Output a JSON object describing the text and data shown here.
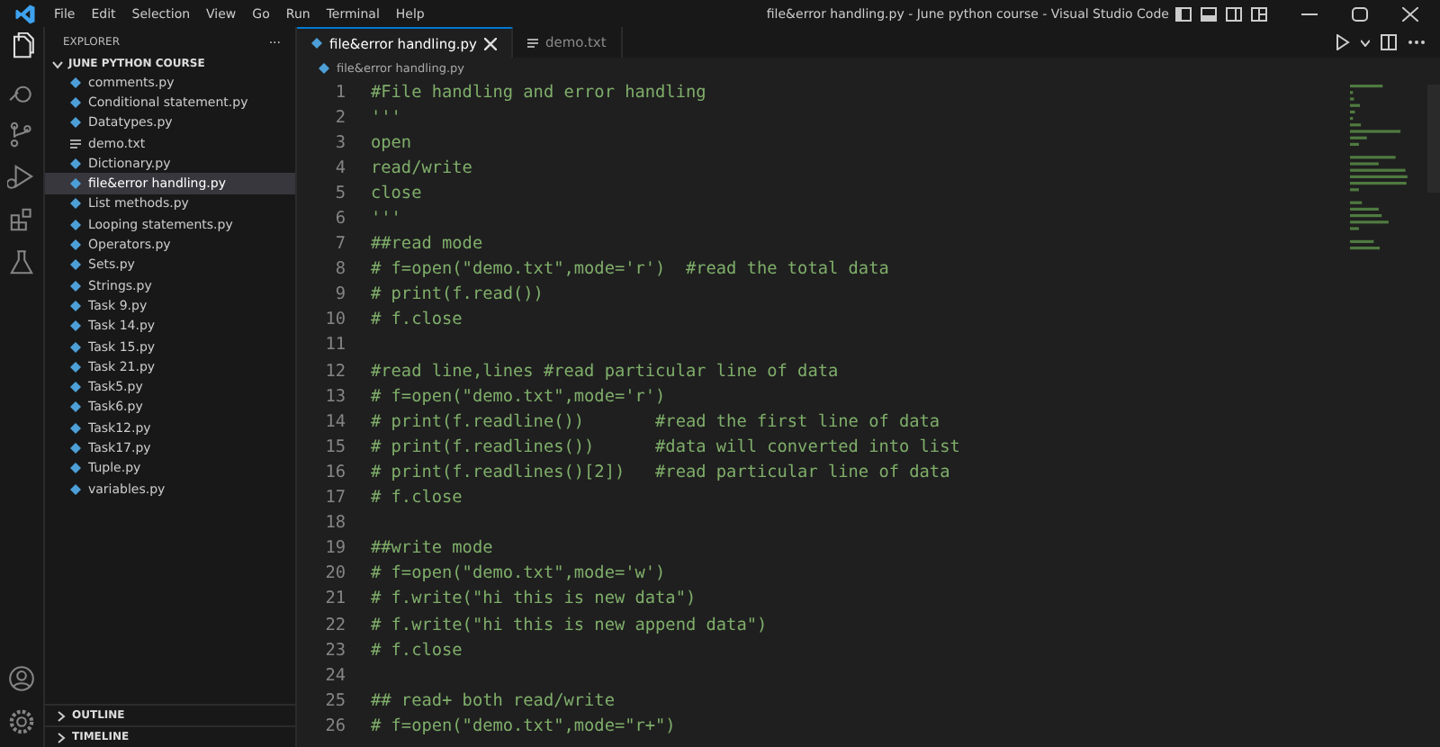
{
  "menu": [
    "File",
    "Edit",
    "Selection",
    "View",
    "Go",
    "Run",
    "Terminal",
    "Help"
  ],
  "window": {
    "title": "file&error handling.py - June python course - Visual Studio Code"
  },
  "activity_bar": [
    {
      "kind": "files",
      "selected": true
    },
    {
      "kind": "search",
      "selected": false
    },
    {
      "kind": "source-control",
      "selected": false
    },
    {
      "kind": "run",
      "selected": false
    },
    {
      "kind": "extensions",
      "selected": false
    },
    {
      "kind": "testing",
      "selected": false
    }
  ],
  "sidebar": {
    "title": "EXPLORER",
    "more": "···",
    "folder": {
      "name": "JUNE PYTHON COURSE",
      "expanded": true
    },
    "items": [
      {
        "name": "comments.py",
        "kind": "py",
        "selected": false
      },
      {
        "name": "Conditional statement.py",
        "kind": "py",
        "selected": false
      },
      {
        "name": "Datatypes.py",
        "kind": "py",
        "selected": false
      },
      {
        "name": "demo.txt",
        "kind": "txt",
        "selected": false
      },
      {
        "name": "Dictionary.py",
        "kind": "py",
        "selected": false
      },
      {
        "name": "file&error handling.py",
        "kind": "py",
        "selected": true
      },
      {
        "name": "List methods.py",
        "kind": "py",
        "selected": false
      },
      {
        "name": "Looping statements.py",
        "kind": "py",
        "selected": false
      },
      {
        "name": "Operators.py",
        "kind": "py",
        "selected": false
      },
      {
        "name": "Sets.py",
        "kind": "py",
        "selected": false
      },
      {
        "name": "Strings.py",
        "kind": "py",
        "selected": false
      },
      {
        "name": "Task 9.py",
        "kind": "py",
        "selected": false
      },
      {
        "name": "Task 14.py",
        "kind": "py",
        "selected": false
      },
      {
        "name": "Task 15.py",
        "kind": "py",
        "selected": false
      },
      {
        "name": "Task 21.py",
        "kind": "py",
        "selected": false
      },
      {
        "name": "Task5.py",
        "kind": "py",
        "selected": false
      },
      {
        "name": "Task6.py",
        "kind": "py",
        "selected": false
      },
      {
        "name": "Task12.py",
        "kind": "py",
        "selected": false
      },
      {
        "name": "Task17.py",
        "kind": "py",
        "selected": false
      },
      {
        "name": "Tuple.py",
        "kind": "py",
        "selected": false
      },
      {
        "name": "variables.py",
        "kind": "py",
        "selected": false
      }
    ],
    "sections": [
      {
        "name": "OUTLINE",
        "expanded": false
      },
      {
        "name": "TIMELINE",
        "expanded": false
      }
    ]
  },
  "tabs": [
    {
      "label": "file&error handling.py",
      "kind": "py",
      "selected": true
    },
    {
      "label": "demo.txt",
      "kind": "txt",
      "selected": false
    }
  ],
  "breadcrumb": "file&error handling.py",
  "code": [
    {
      "number": "1",
      "text": "#File handling and error handling"
    },
    {
      "number": "2",
      "text": "'''"
    },
    {
      "number": "3",
      "text": "open"
    },
    {
      "number": "4",
      "text": "read/write"
    },
    {
      "number": "5",
      "text": "close"
    },
    {
      "number": "6",
      "text": "'''"
    },
    {
      "number": "7",
      "text": "##read mode"
    },
    {
      "number": "8",
      "text": "# f=open(\"demo.txt\",mode='r')  #read the total data"
    },
    {
      "number": "9",
      "text": "# print(f.read())"
    },
    {
      "number": "10",
      "text": "# f.close"
    },
    {
      "number": "11"
    },
    {
      "number": "12",
      "text": "#read line,lines #read particular line of data"
    },
    {
      "number": "13",
      "text": "# f=open(\"demo.txt\",mode='r')"
    },
    {
      "number": "14",
      "text": "# print(f.readline())       #read the first line of data"
    },
    {
      "number": "15",
      "text": "# print(f.readlines())      #data will converted into list"
    },
    {
      "number": "16",
      "text": "# print(f.readlines()[2])   #read particular line of data"
    },
    {
      "number": "17",
      "text": "# f.close"
    },
    {
      "number": "18"
    },
    {
      "number": "19",
      "text": "##write mode"
    },
    {
      "number": "20",
      "text": "# f=open(\"demo.txt\",mode='w')"
    },
    {
      "number": "21",
      "text": "# f.write(\"hi this is new data\")"
    },
    {
      "number": "22",
      "text": "# f.write(\"hi this is new append data\")"
    },
    {
      "number": "23",
      "text": "# f.close"
    },
    {
      "number": "24"
    },
    {
      "number": "25",
      "text": "## read+ both read/write"
    },
    {
      "number": "26",
      "text": "# f=open(\"demo.txt\",mode=\"r+\")"
    }
  ]
}
